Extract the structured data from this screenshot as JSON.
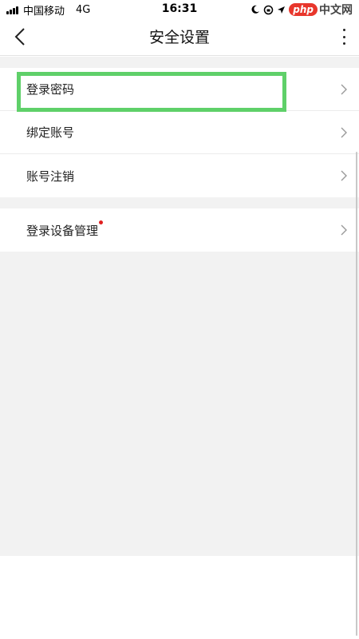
{
  "status_bar": {
    "carrier": "中国移动",
    "network": "4G",
    "time": "16:31",
    "watermark_php": "php",
    "watermark_cn": "中文网"
  },
  "nav": {
    "title": "安全设置",
    "back_icon": "chevron-left-icon",
    "more_icon": "more-vertical-icon"
  },
  "groups": [
    {
      "items": [
        {
          "label": "登录密码",
          "highlighted": true
        },
        {
          "label": "绑定账号"
        },
        {
          "label": "账号注销"
        }
      ]
    },
    {
      "items": [
        {
          "label": "登录设备管理",
          "badge": "red-dot"
        }
      ]
    }
  ],
  "colors": {
    "highlight": "#5fd069",
    "badge": "#e02020",
    "background": "#f2f2f2"
  }
}
